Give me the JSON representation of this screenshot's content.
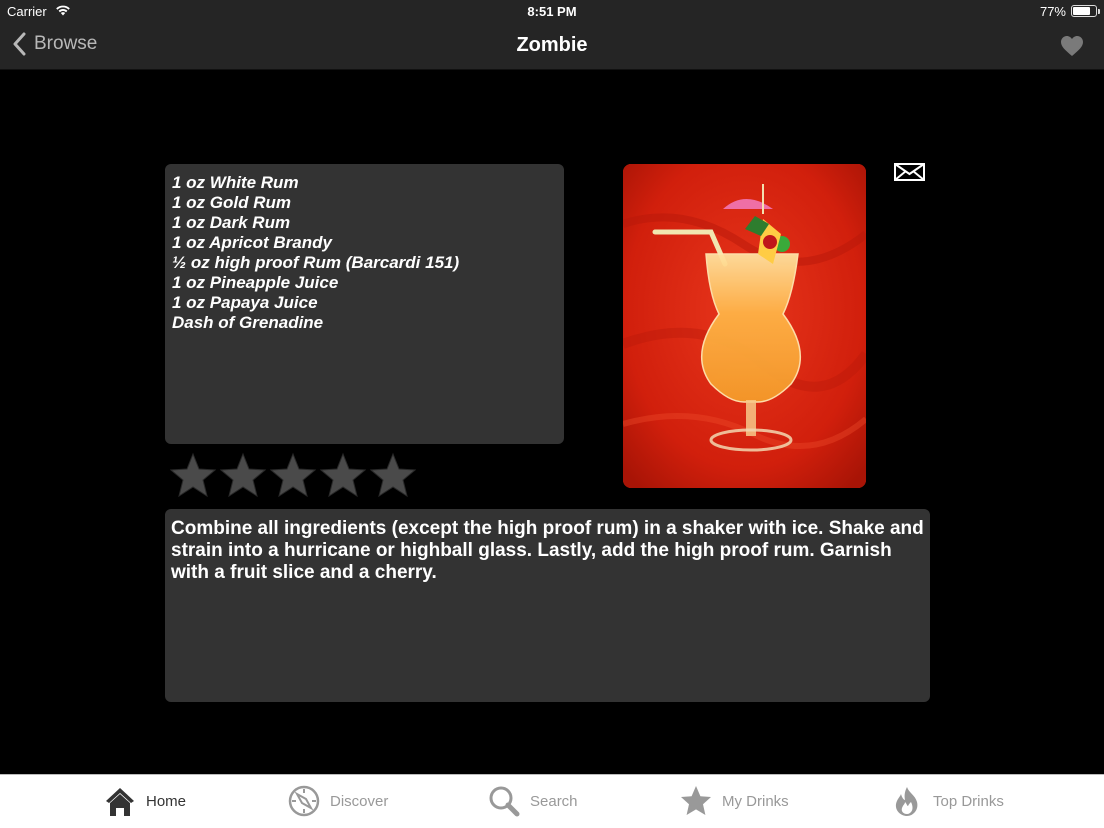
{
  "status_bar": {
    "carrier": "Carrier",
    "time": "8:51 PM",
    "battery_percent": "77%",
    "battery_level": 0.77
  },
  "nav": {
    "back_label": "Browse",
    "title": "Zombie",
    "favorite_icon": "heart-icon"
  },
  "recipe": {
    "ingredients": [
      "1 oz White Rum",
      "1 oz Gold Rum",
      "1 oz Dark Rum",
      "1 oz Apricot Brandy",
      "½ oz high proof Rum (Barcardi 151)",
      "1 oz Pineapple Juice",
      "1 oz Papaya Juice",
      "Dash of Grenadine"
    ],
    "rating": {
      "value": 0,
      "max": 5
    },
    "instructions": "Combine all ingredients (except the high proof rum) in a shaker with ice. Shake and strain into a hurricane or highball glass. Lastly, add the high proof rum. Garnish with a fruit slice and a cherry.",
    "photo_alt": "Zombie cocktail in a hurricane glass with umbrella garnish",
    "share_icon": "mail-icon"
  },
  "tabbar": {
    "items": [
      {
        "label": "Home",
        "icon": "home-icon",
        "active": true
      },
      {
        "label": "Discover",
        "icon": "compass-icon",
        "active": false
      },
      {
        "label": "Search",
        "icon": "search-icon",
        "active": false
      },
      {
        "label": "My Drinks",
        "icon": "star-icon",
        "active": false
      },
      {
        "label": "Top Drinks",
        "icon": "flame-icon",
        "active": false
      }
    ]
  },
  "colors": {
    "nav_background": "#252525",
    "panel_background": "#333333",
    "tab_active": "#333333",
    "tab_inactive": "#999999",
    "star_empty": "#4a4a4a"
  }
}
